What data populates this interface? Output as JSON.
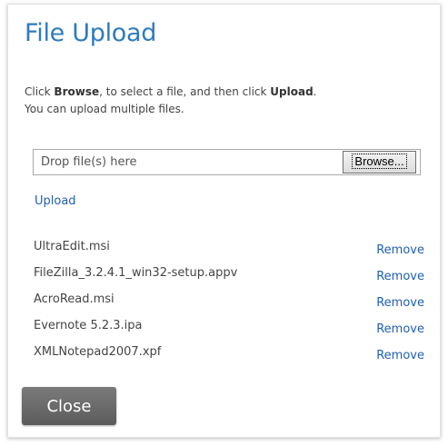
{
  "dialog": {
    "title": "File Upload",
    "instructions": {
      "line1_prefix": "Click ",
      "line1_browse": "Browse",
      "line1_middle": ", to select a file, and then click ",
      "line1_upload": "Upload",
      "line1_suffix": ".",
      "line2": "You can upload multiple files."
    },
    "drop_zone": {
      "placeholder": "Drop file(s) here",
      "value": ""
    },
    "browse_label": "Browse...",
    "upload_label": "Upload",
    "files": [
      {
        "name": "UltraEdit.msi",
        "remove_label": "Remove"
      },
      {
        "name": "FileZilla_3.2.4.1_win32-setup.appv",
        "remove_label": "Remove"
      },
      {
        "name": "AcroRead.msi",
        "remove_label": "Remove"
      },
      {
        "name": "Evernote 5.2.3.ipa",
        "remove_label": "Remove"
      },
      {
        "name": "XMLNotepad2007.xpf",
        "remove_label": "Remove"
      }
    ],
    "close_label": "Close"
  },
  "colors": {
    "title": "#2e7bbf",
    "link": "#1f5fb4",
    "close_button": "#6b6b6b",
    "text": "#444444"
  }
}
